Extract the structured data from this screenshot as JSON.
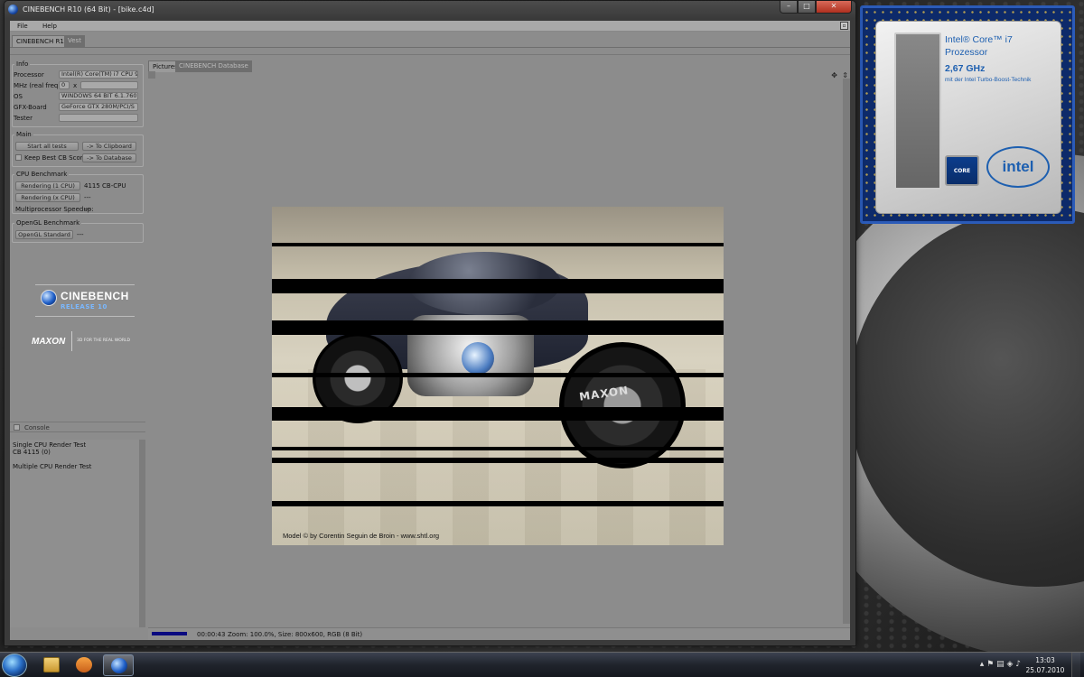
{
  "window": {
    "title": "CINEBENCH R10 (64 Bit) - [bike.c4d]",
    "menu": [
      "File",
      "Help"
    ],
    "tabs": [
      "CINEBENCH R10",
      "Vest"
    ]
  },
  "info": {
    "legend": "Info",
    "processor_label": "Processor",
    "processor_value": "Intel(R) Core(TM) i7 CPU 920 @ 2.67GHz",
    "mhz_label": "MHz (real freq.)",
    "mhz_value": "0",
    "mhz_x": "x",
    "os_label": "OS",
    "os_value": "WINDOWS 64 BIT 6.1.760",
    "gfx_label": "GFX-Board",
    "gfx_value": "GeForce GTX 280M/PCI/S",
    "tester_label": "Tester",
    "tester_value": ""
  },
  "main": {
    "legend": "Main",
    "start_all": "Start all tests",
    "to_clipboard": "-> To Clipboard",
    "keep_best": "Keep Best CB Score",
    "to_database": "-> To Database"
  },
  "cpu": {
    "legend": "CPU Benchmark",
    "rendering_1": "Rendering (1 CPU)",
    "rendering_1_value": "4115 CB-CPU",
    "rendering_x": "Rendering (x CPU)",
    "rendering_x_value": "---",
    "speedup_label": "Multiprocessor Speedup:",
    "speedup_value": "---"
  },
  "opengl": {
    "legend": "OpenGL Benchmark",
    "standard": "OpenGL Standard",
    "standard_value": "---"
  },
  "logo": {
    "cinebench": "CINEBENCH",
    "release": "RELEASE 10",
    "maxon": "MAXON",
    "slogan": "3D FOR THE REAL WORLD"
  },
  "console": {
    "header": "Console",
    "lines": [
      "Single CPU Render Test",
      "CB 4115 (0)",
      "",
      "Multiple CPU Render Test"
    ]
  },
  "pictures": {
    "tab_pictures": "Pictures",
    "tab_database": "CINEBENCH Database",
    "caption": "Model © by Corentin Seguin de Broin - www.shtl.org",
    "bike_text": "MAXON"
  },
  "status": {
    "progress": 0.15,
    "time": "00:00:43",
    "info": "Zoom: 100.0%, Size: 800x600, RGB (8 Bit)"
  },
  "intel": {
    "line1": "Intel® Core™ i7",
    "line2": "Prozessor",
    "line3": "2,67 GHz",
    "line4": "mit der Intel Turbo-Boost-Technik",
    "core_logo": "CORE",
    "brand": "intel"
  },
  "taskbar": {
    "time": "13:03",
    "date": "25.07.2010",
    "icons": [
      "start-orb-icon",
      "explorer-folder-icon",
      "media-player-icon",
      "cinebench-icon"
    ]
  },
  "colors": {
    "accent": "#1d5fb0",
    "progress": "#0a0a80"
  }
}
